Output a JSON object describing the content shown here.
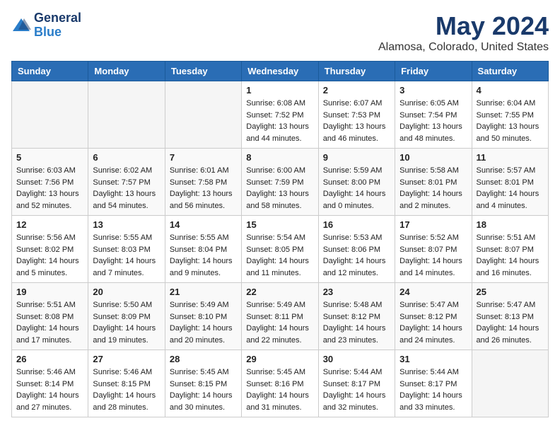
{
  "header": {
    "logo_line1": "General",
    "logo_line2": "Blue",
    "title": "May 2024",
    "subtitle": "Alamosa, Colorado, United States"
  },
  "weekdays": [
    "Sunday",
    "Monday",
    "Tuesday",
    "Wednesday",
    "Thursday",
    "Friday",
    "Saturday"
  ],
  "weeks": [
    [
      {
        "day": "",
        "empty": true
      },
      {
        "day": "",
        "empty": true
      },
      {
        "day": "",
        "empty": true
      },
      {
        "day": "1",
        "sunrise": "6:08 AM",
        "sunset": "7:52 PM",
        "daylight": "13 hours and 44 minutes."
      },
      {
        "day": "2",
        "sunrise": "6:07 AM",
        "sunset": "7:53 PM",
        "daylight": "13 hours and 46 minutes."
      },
      {
        "day": "3",
        "sunrise": "6:05 AM",
        "sunset": "7:54 PM",
        "daylight": "13 hours and 48 minutes."
      },
      {
        "day": "4",
        "sunrise": "6:04 AM",
        "sunset": "7:55 PM",
        "daylight": "13 hours and 50 minutes."
      }
    ],
    [
      {
        "day": "5",
        "sunrise": "6:03 AM",
        "sunset": "7:56 PM",
        "daylight": "13 hours and 52 minutes."
      },
      {
        "day": "6",
        "sunrise": "6:02 AM",
        "sunset": "7:57 PM",
        "daylight": "13 hours and 54 minutes."
      },
      {
        "day": "7",
        "sunrise": "6:01 AM",
        "sunset": "7:58 PM",
        "daylight": "13 hours and 56 minutes."
      },
      {
        "day": "8",
        "sunrise": "6:00 AM",
        "sunset": "7:59 PM",
        "daylight": "13 hours and 58 minutes."
      },
      {
        "day": "9",
        "sunrise": "5:59 AM",
        "sunset": "8:00 PM",
        "daylight": "14 hours and 0 minutes."
      },
      {
        "day": "10",
        "sunrise": "5:58 AM",
        "sunset": "8:01 PM",
        "daylight": "14 hours and 2 minutes."
      },
      {
        "day": "11",
        "sunrise": "5:57 AM",
        "sunset": "8:01 PM",
        "daylight": "14 hours and 4 minutes."
      }
    ],
    [
      {
        "day": "12",
        "sunrise": "5:56 AM",
        "sunset": "8:02 PM",
        "daylight": "14 hours and 5 minutes."
      },
      {
        "day": "13",
        "sunrise": "5:55 AM",
        "sunset": "8:03 PM",
        "daylight": "14 hours and 7 minutes."
      },
      {
        "day": "14",
        "sunrise": "5:55 AM",
        "sunset": "8:04 PM",
        "daylight": "14 hours and 9 minutes."
      },
      {
        "day": "15",
        "sunrise": "5:54 AM",
        "sunset": "8:05 PM",
        "daylight": "14 hours and 11 minutes."
      },
      {
        "day": "16",
        "sunrise": "5:53 AM",
        "sunset": "8:06 PM",
        "daylight": "14 hours and 12 minutes."
      },
      {
        "day": "17",
        "sunrise": "5:52 AM",
        "sunset": "8:07 PM",
        "daylight": "14 hours and 14 minutes."
      },
      {
        "day": "18",
        "sunrise": "5:51 AM",
        "sunset": "8:07 PM",
        "daylight": "14 hours and 16 minutes."
      }
    ],
    [
      {
        "day": "19",
        "sunrise": "5:51 AM",
        "sunset": "8:08 PM",
        "daylight": "14 hours and 17 minutes."
      },
      {
        "day": "20",
        "sunrise": "5:50 AM",
        "sunset": "8:09 PM",
        "daylight": "14 hours and 19 minutes."
      },
      {
        "day": "21",
        "sunrise": "5:49 AM",
        "sunset": "8:10 PM",
        "daylight": "14 hours and 20 minutes."
      },
      {
        "day": "22",
        "sunrise": "5:49 AM",
        "sunset": "8:11 PM",
        "daylight": "14 hours and 22 minutes."
      },
      {
        "day": "23",
        "sunrise": "5:48 AM",
        "sunset": "8:12 PM",
        "daylight": "14 hours and 23 minutes."
      },
      {
        "day": "24",
        "sunrise": "5:47 AM",
        "sunset": "8:12 PM",
        "daylight": "14 hours and 24 minutes."
      },
      {
        "day": "25",
        "sunrise": "5:47 AM",
        "sunset": "8:13 PM",
        "daylight": "14 hours and 26 minutes."
      }
    ],
    [
      {
        "day": "26",
        "sunrise": "5:46 AM",
        "sunset": "8:14 PM",
        "daylight": "14 hours and 27 minutes."
      },
      {
        "day": "27",
        "sunrise": "5:46 AM",
        "sunset": "8:15 PM",
        "daylight": "14 hours and 28 minutes."
      },
      {
        "day": "28",
        "sunrise": "5:45 AM",
        "sunset": "8:15 PM",
        "daylight": "14 hours and 30 minutes."
      },
      {
        "day": "29",
        "sunrise": "5:45 AM",
        "sunset": "8:16 PM",
        "daylight": "14 hours and 31 minutes."
      },
      {
        "day": "30",
        "sunrise": "5:44 AM",
        "sunset": "8:17 PM",
        "daylight": "14 hours and 32 minutes."
      },
      {
        "day": "31",
        "sunrise": "5:44 AM",
        "sunset": "8:17 PM",
        "daylight": "14 hours and 33 minutes."
      },
      {
        "day": "",
        "empty": true
      }
    ]
  ]
}
